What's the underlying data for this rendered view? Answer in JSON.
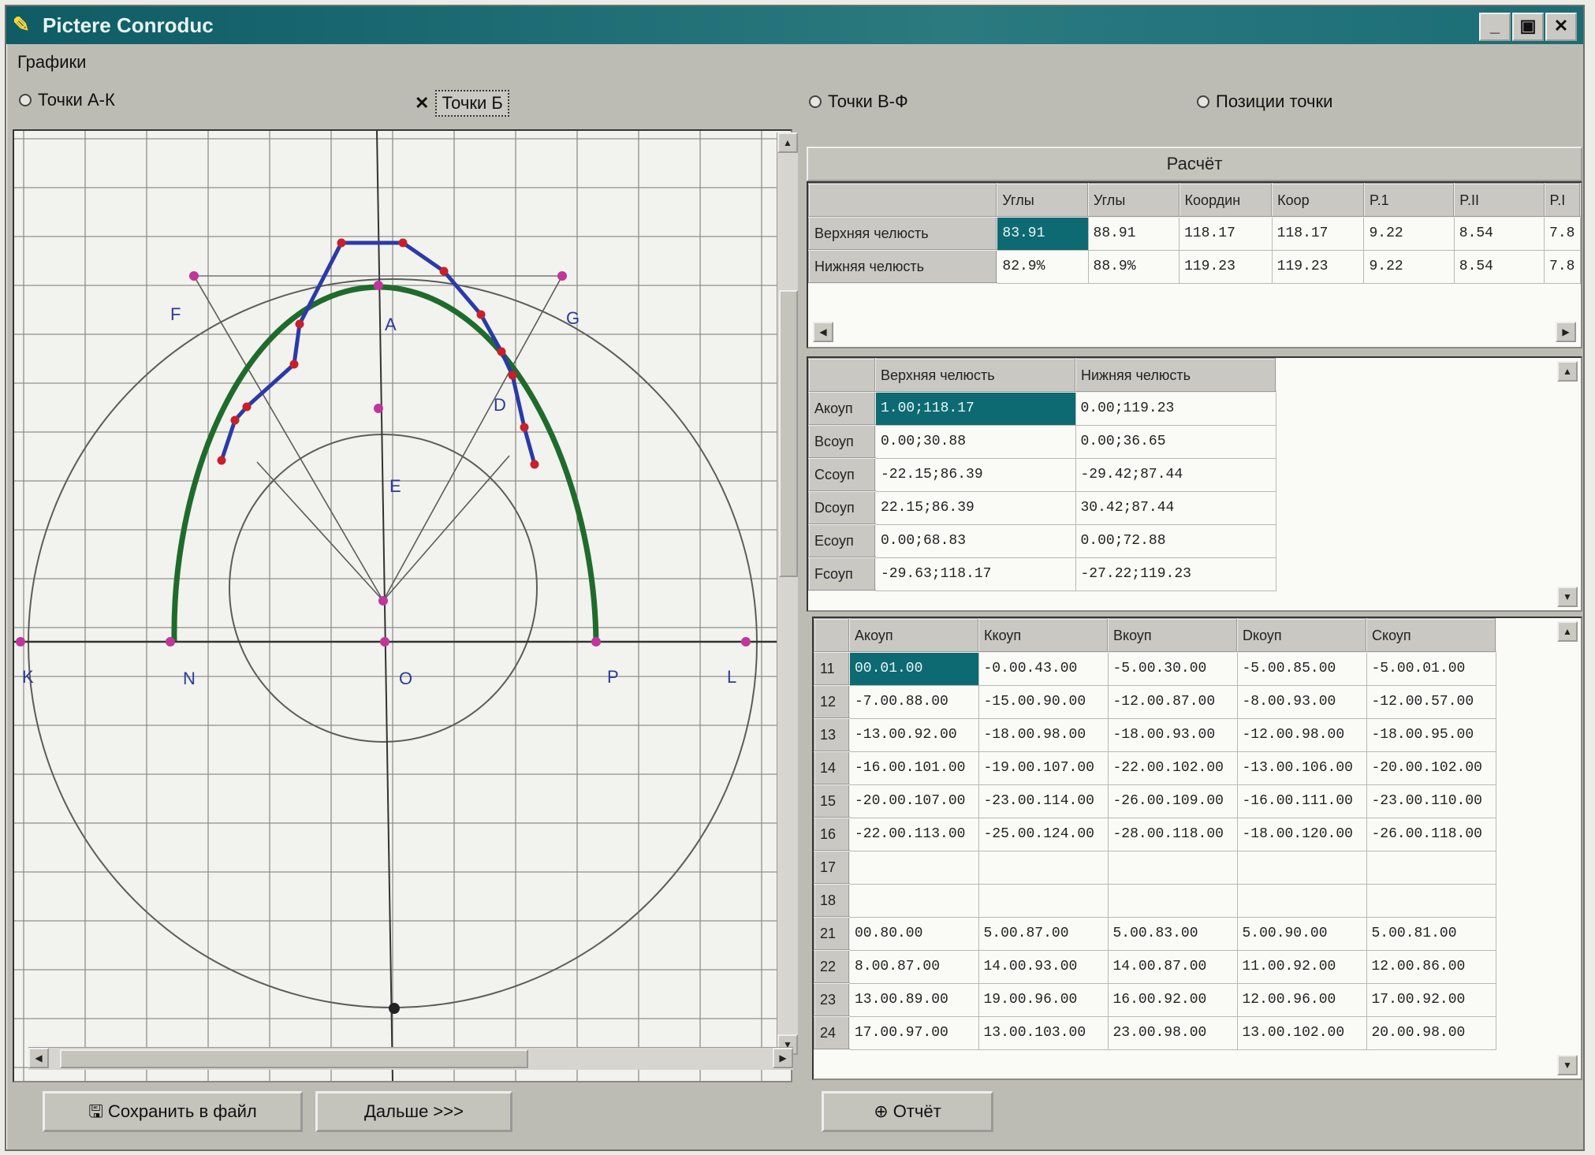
{
  "window": {
    "title": "Pictere Conroduc",
    "buttons": [
      "_",
      "▣",
      "✕"
    ]
  },
  "menu": {
    "graph_label": "Графики"
  },
  "radios": [
    {
      "label": "Точки А-К",
      "selected": false
    },
    {
      "label": "Точки Б",
      "selected": true
    },
    {
      "label": "Точки В-Ф",
      "selected": false
    },
    {
      "label": "Позиции точки",
      "selected": false
    }
  ],
  "diagram": {
    "point_labels": [
      "F",
      "A",
      "G",
      "D",
      "E",
      "K",
      "N",
      "O",
      "P",
      "L"
    ],
    "colors": {
      "grid": "#8e8e8a",
      "construction": "#5c5c5c",
      "arc_green": "#1f6b2c",
      "polyline_blue": "#2a3aa8",
      "point_red": "#c81f2a",
      "point_magenta": "#c0369a"
    }
  },
  "result": {
    "title": "Расчёт",
    "columns": [
      "Углы",
      "Углы",
      "Координ",
      "Коор",
      "P.1",
      "P.II",
      "P.I"
    ],
    "rows": [
      {
        "label": "Верхняя челюсть",
        "cells": [
          "83.91",
          "88.91",
          "118.17",
          "118.17",
          "9.22",
          "8.54",
          "7.8"
        ]
      },
      {
        "label": "Нижняя челюсть",
        "cells": [
          "82.9%",
          "88.9%",
          "119.23",
          "119.23",
          "9.22",
          "8.54",
          "7.8"
        ]
      }
    ]
  },
  "jaw_table": {
    "columns": [
      "Верхняя челюсть",
      "Нижняя челюсть"
    ],
    "rows": [
      {
        "label": "Акоуп",
        "upper": "1.00;118.17",
        "lower": "0.00;119.23"
      },
      {
        "label": "Всоуп",
        "upper": "0.00;30.88",
        "lower": "0.00;36.65"
      },
      {
        "label": "Ссоуп",
        "upper": "-22.15;86.39",
        "lower": "-29.42;87.44"
      },
      {
        "label": "Dcoуп",
        "upper": "22.15;86.39",
        "lower": "30.42;87.44"
      },
      {
        "label": "Ecoуп",
        "upper": "0.00;68.83",
        "lower": "0.00;72.88"
      },
      {
        "label": "Fcoуп",
        "upper": "-29.63;118.17",
        "lower": "-27.22;119.23"
      }
    ]
  },
  "tooth_table": {
    "columns": [
      "Акоуп",
      "Ккоуп",
      "Вкоуп",
      "Dкоуп",
      "Скоуп"
    ],
    "rows": [
      {
        "num": "11",
        "cells": [
          "00.01.00",
          "-0.00.43.00",
          "-5.00.30.00",
          "-5.00.85.00",
          "-5.00.01.00"
        ]
      },
      {
        "num": "12",
        "cells": [
          "-7.00.88.00",
          "-15.00.90.00",
          "-12.00.87.00",
          "-8.00.93.00",
          "-12.00.57.00"
        ]
      },
      {
        "num": "13",
        "cells": [
          "-13.00.92.00",
          "-18.00.98.00",
          "-18.00.93.00",
          "-12.00.98.00",
          "-18.00.95.00"
        ]
      },
      {
        "num": "14",
        "cells": [
          "-16.00.101.00",
          "-19.00.107.00",
          "-22.00.102.00",
          "-13.00.106.00",
          "-20.00.102.00"
        ]
      },
      {
        "num": "15",
        "cells": [
          "-20.00.107.00",
          "-23.00.114.00",
          "-26.00.109.00",
          "-16.00.111.00",
          "-23.00.110.00"
        ]
      },
      {
        "num": "16",
        "cells": [
          "-22.00.113.00",
          "-25.00.124.00",
          "-28.00.118.00",
          "-18.00.120.00",
          "-26.00.118.00"
        ]
      },
      {
        "num": "17",
        "cells": [
          "",
          "",
          "",
          "",
          ""
        ]
      },
      {
        "num": "18",
        "cells": [
          "",
          "",
          "",
          "",
          ""
        ]
      },
      {
        "num": "21",
        "cells": [
          "00.80.00",
          "5.00.87.00",
          "5.00.83.00",
          "5.00.90.00",
          "5.00.81.00"
        ]
      },
      {
        "num": "22",
        "cells": [
          "8.00.87.00",
          "14.00.93.00",
          "14.00.87.00",
          "11.00.92.00",
          "12.00.86.00"
        ]
      },
      {
        "num": "23",
        "cells": [
          "13.00.89.00",
          "19.00.96.00",
          "16.00.92.00",
          "12.00.96.00",
          "17.00.92.00"
        ]
      },
      {
        "num": "24",
        "cells": [
          "17.00.97.00",
          "13.00.103.00",
          "23.00.98.00",
          "13.00.102.00",
          "20.00.98.00"
        ]
      }
    ]
  },
  "buttons": {
    "save": "Сохранить в файл",
    "next": "Дальше >>>",
    "report": "Отчёт"
  }
}
